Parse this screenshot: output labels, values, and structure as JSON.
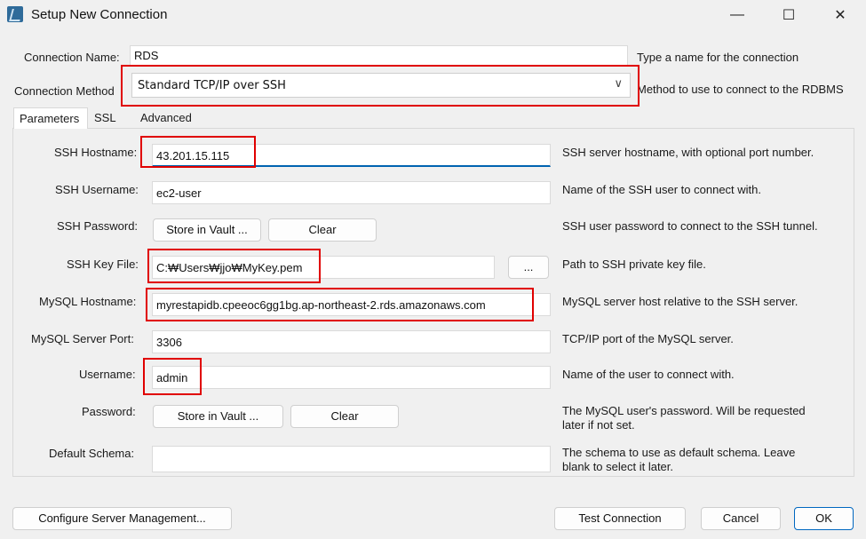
{
  "window": {
    "title": "Setup New Connection",
    "minimize_glyph": "—",
    "maximize_glyph": "☐",
    "close_glyph": "✕"
  },
  "connection": {
    "name_label": "Connection Name:",
    "name_value": "RDS",
    "name_desc": "Type a name for the connection",
    "method_label": "Connection Method",
    "method_value": "Standard TCP/IP over SSH",
    "method_desc": "Method to use to connect to the RDBMS"
  },
  "tabs": [
    {
      "label": "Parameters",
      "active": true
    },
    {
      "label": "SSL",
      "active": false
    },
    {
      "label": "Advanced",
      "active": false
    }
  ],
  "params": {
    "ssh_hostname": {
      "label": "SSH Hostname:",
      "value": "43.201.15.115",
      "desc": "SSH server hostname, with  optional port number."
    },
    "ssh_username": {
      "label": "SSH Username:",
      "value": "ec2-user",
      "desc": "Name of the SSH user to connect with."
    },
    "ssh_password": {
      "label": "SSH Password:",
      "store_label": "Store in Vault ...",
      "clear_label": "Clear",
      "desc": "SSH user password to connect to the SSH tunnel."
    },
    "ssh_key_file": {
      "label": "SSH Key File:",
      "value": "C:₩Users₩jjo₩MyKey.pem",
      "browse_label": "...",
      "desc": "Path to SSH private key file."
    },
    "mysql_hostname": {
      "label": "MySQL Hostname:",
      "value": "myrestapidb.cpeeoc6gg1bg.ap-northeast-2.rds.amazonaws.com",
      "desc": "MySQL server host relative to the SSH server."
    },
    "mysql_port": {
      "label": "MySQL Server Port:",
      "value": "3306",
      "desc": "TCP/IP port of the MySQL server."
    },
    "username": {
      "label": "Username:",
      "value": "admin",
      "desc": "Name of the user to connect with."
    },
    "password": {
      "label": "Password:",
      "store_label": "Store in Vault ...",
      "clear_label": "Clear",
      "desc_line1": "The MySQL user's password. Will be requested",
      "desc_line2": "later if not set."
    },
    "default_schema": {
      "label": "Default Schema:",
      "value": "",
      "desc_line1": "The schema to use as default schema. Leave",
      "desc_line2": "blank to select it later."
    }
  },
  "footer": {
    "configure_label": "Configure Server Management...",
    "test_label": "Test Connection",
    "cancel_label": "Cancel",
    "ok_label": "OK"
  },
  "colors": {
    "highlight": "#e00000",
    "focus_accent": "#0063b1"
  }
}
